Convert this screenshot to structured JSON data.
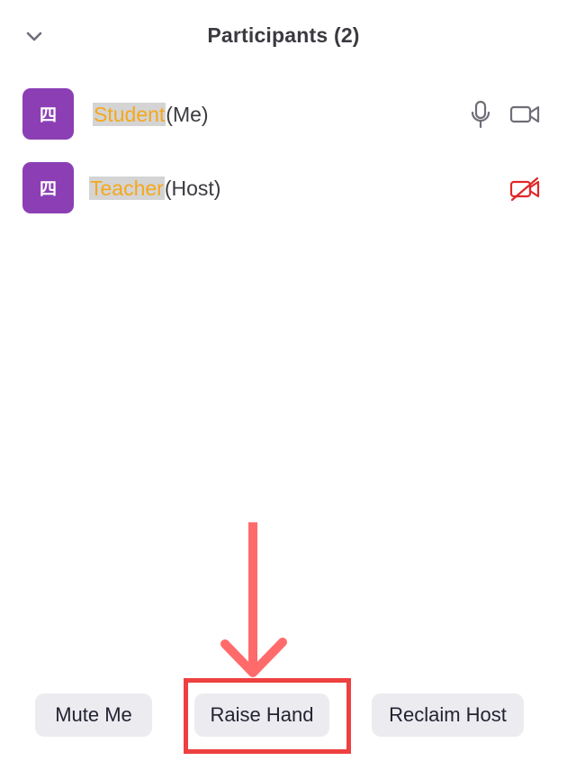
{
  "header": {
    "title": "Participants (2)",
    "collapse_icon": "chevron-down-icon"
  },
  "participants": [
    {
      "avatar_text": "四",
      "name": "Student",
      "role": "(Me)",
      "mic_icon": "microphone-icon",
      "video_icon": "video-camera-icon"
    },
    {
      "avatar_text": "四",
      "name": "Teacher",
      "role": "(Host)",
      "video_icon": "video-camera-off-icon"
    }
  ],
  "footer": {
    "buttons": [
      {
        "label": "Mute Me"
      },
      {
        "label": "Raise Hand"
      },
      {
        "label": "Reclaim Host"
      }
    ]
  },
  "colors": {
    "avatar": "#8c3fb5",
    "name_highlight_text": "#f4a81c",
    "name_highlight_bg": "#d4d4d4",
    "video_off": "#e02828",
    "annotation": "#ee4040",
    "button_bg": "#ececf0"
  },
  "annotations": {
    "arrow_target": "Raise Hand",
    "highlight_box_target": "Raise Hand"
  }
}
